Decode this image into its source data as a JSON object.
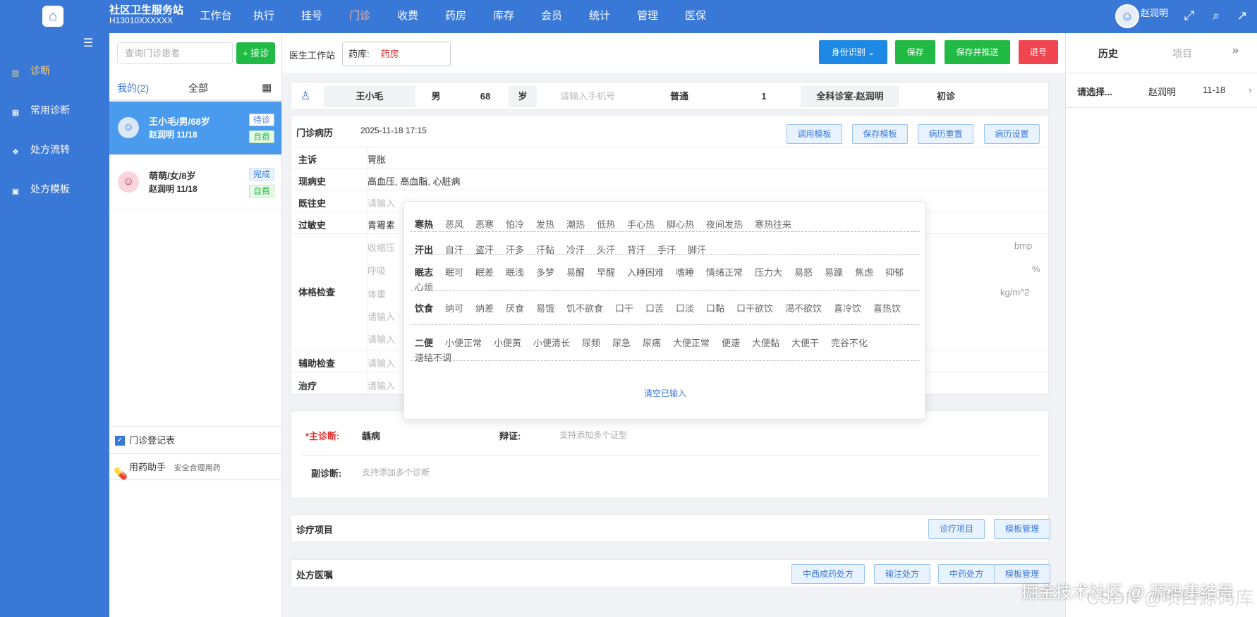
{
  "app": {
    "title": "社区卫生服务站",
    "code": "H13010XXXXXX"
  },
  "nav": [
    "工作台",
    "执行",
    "挂号",
    "门诊",
    "收费",
    "药房",
    "库存",
    "会员",
    "统计",
    "管理",
    "医保"
  ],
  "user": {
    "name": "赵润明"
  },
  "sidebar": {
    "items": [
      {
        "label": "诊断"
      },
      {
        "label": "常用诊断"
      },
      {
        "label": "处方流转"
      },
      {
        "label": "处方模板"
      }
    ]
  },
  "plist": {
    "search_placeholder": "查询门诊患者",
    "receive": "+ 接诊",
    "tab_mine": "我的(2)",
    "tab_all": "全部",
    "patients": [
      {
        "line1": "王小毛/男/68岁",
        "line2": "赵润明   11/18",
        "status": "待诊",
        "pay": "自费"
      },
      {
        "line1": "萌萌/女/8岁",
        "line2": "赵润明   11/18",
        "status": "完成",
        "pay": "自费"
      }
    ],
    "tools": [
      {
        "label": "门诊登记表"
      },
      {
        "label": "用药助手",
        "sub": "安全合理用药"
      }
    ]
  },
  "workstation": {
    "label": "医生工作站",
    "pharmacy_label": "药库:",
    "pharmacy_value": "药房",
    "id_btn": "身份识别",
    "save": "保存",
    "save_push": "保存并推送",
    "refund": "退号"
  },
  "patient": {
    "name": "王小毛",
    "sex": "男",
    "age": "68",
    "age_unit": "岁",
    "phone_placeholder": "请输入手机号",
    "visit_type": "普通",
    "num": "1",
    "dept": "全科诊室-赵润明",
    "visit": "初诊"
  },
  "record": {
    "title": "门诊病历",
    "datetime": "2025-11-18 17:15",
    "btn_template": "调用模板",
    "btn_save_template": "保存模板",
    "btn_reset": "病历重置",
    "btn_settings": "病历设置",
    "chief_label": "主诉",
    "chief": "胃胀",
    "present_label": "现病史",
    "present": "高血压, 高血脂, 心脏病",
    "past_label": "既往史",
    "past_placeholder": "请输入",
    "allergy_label": "过敏史",
    "allergy": "青霉素",
    "exam_label": "体格检查",
    "exam_fields": [
      "收缩压",
      "呼吸",
      "体重",
      "请输入",
      "请输入"
    ],
    "exam_units": [
      "bmp",
      "%",
      "kg/m^2"
    ],
    "aux_label": "辅助检查",
    "aux_placeholder": "请输入",
    "treat_label": "治疗",
    "treat_placeholder": "请输入"
  },
  "popup": {
    "groups": [
      {
        "title": "寒热",
        "items": [
          "恶风",
          "恶寒",
          "怕冷",
          "发热",
          "潮热",
          "低热",
          "手心热",
          "脚心热",
          "夜间发热",
          "寒热往来"
        ]
      },
      {
        "title": "汗出",
        "items": [
          "自汗",
          "盗汗",
          "汗多",
          "汗黏",
          "冷汗",
          "头汗",
          "背汗",
          "手汗",
          "脚汗"
        ]
      },
      {
        "title": "眠志",
        "items": [
          "眠可",
          "眠差",
          "眠浅",
          "多梦",
          "易醒",
          "早醒",
          "入睡困难",
          "嗜睡",
          "情绪正常",
          "压力大",
          "易怒",
          "易躁",
          "焦虑",
          "抑郁",
          "心烦"
        ]
      },
      {
        "title": "饮食",
        "items": [
          "纳可",
          "纳差",
          "厌食",
          "易饿",
          "饥不欲食",
          "口干",
          "口苦",
          "口淡",
          "口黏",
          "口干欲饮",
          "渴不欲饮",
          "喜冷饮",
          "喜热饮"
        ]
      },
      {
        "title": "二便",
        "items": [
          "小便正常",
          "小便黄",
          "小便清长",
          "尿频",
          "尿急",
          "尿痛",
          "大便正常",
          "便溏",
          "大便黏",
          "大便干",
          "完谷不化",
          "溏结不调"
        ]
      }
    ],
    "clear": "清空已输入"
  },
  "diagnosis": {
    "main_label": "*主诊断:",
    "main_value": "龋病",
    "syndrome_label": "辩证:",
    "syndrome_placeholder": "支持添加多个证型",
    "sub_label": "副诊断:",
    "sub_placeholder": "支持添加多个诊断"
  },
  "treatment": {
    "title": "诊疗项目",
    "btn_items": "诊疗项目",
    "btn_manage": "模板管理"
  },
  "prescription": {
    "title": "处方医嘱",
    "btn_west": "中西成药处方",
    "btn_infusion": "输注处方",
    "btn_tcm": "中药处方",
    "btn_manage": "模板管理"
  },
  "right": {
    "tab_history": "历史",
    "tab_items": "项目",
    "row": {
      "select": "请选择...",
      "doctor": "赵润明",
      "date": "11-18"
    }
  },
  "watermark": "掘金技术社区 @ 源码集结号",
  "watermark2": "CSDN @项目源码库"
}
